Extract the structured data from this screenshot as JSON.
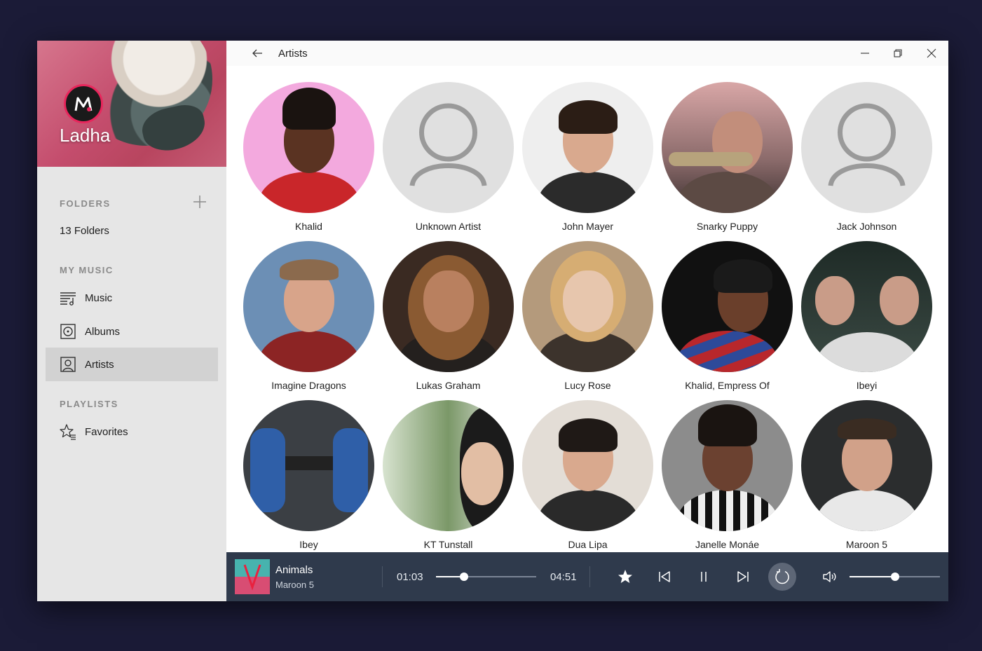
{
  "app": {
    "name": "Ladha"
  },
  "sidebar": {
    "folders_label": "FOLDERS",
    "folders_count": "13 Folders",
    "my_music_label": "MY MUSIC",
    "items": [
      {
        "label": "Music",
        "icon": "music-list-icon"
      },
      {
        "label": "Albums",
        "icon": "album-icon"
      },
      {
        "label": "Artists",
        "icon": "artist-icon",
        "active": true
      }
    ],
    "playlists_label": "PLAYLISTS",
    "playlists": [
      {
        "label": "Favorites",
        "icon": "favorites-star-icon"
      }
    ]
  },
  "header": {
    "title": "Artists"
  },
  "artists": [
    {
      "name": "Khalid"
    },
    {
      "name": "Unknown Artist"
    },
    {
      "name": "John Mayer"
    },
    {
      "name": "Snarky Puppy"
    },
    {
      "name": "Jack Johnson"
    },
    {
      "name": "Imagine Dragons"
    },
    {
      "name": "Lukas Graham"
    },
    {
      "name": "Lucy Rose"
    },
    {
      "name": "Khalid, Empress Of"
    },
    {
      "name": "Ibeyi"
    },
    {
      "name": "Ibey"
    },
    {
      "name": "KT Tunstall"
    },
    {
      "name": "Dua Lipa"
    },
    {
      "name": "Janelle Monáe"
    },
    {
      "name": "Maroon 5"
    }
  ],
  "player": {
    "title": "Animals",
    "artist": "Maroon 5",
    "elapsed": "01:03",
    "duration": "04:51",
    "progress": 0.28,
    "volume": 0.5
  },
  "colors": {
    "accent": "#e8265c",
    "player_bg": "#2f3a4c",
    "sidebar_bg": "#e6e6e6",
    "desktop_bg": "#1b1b37"
  }
}
